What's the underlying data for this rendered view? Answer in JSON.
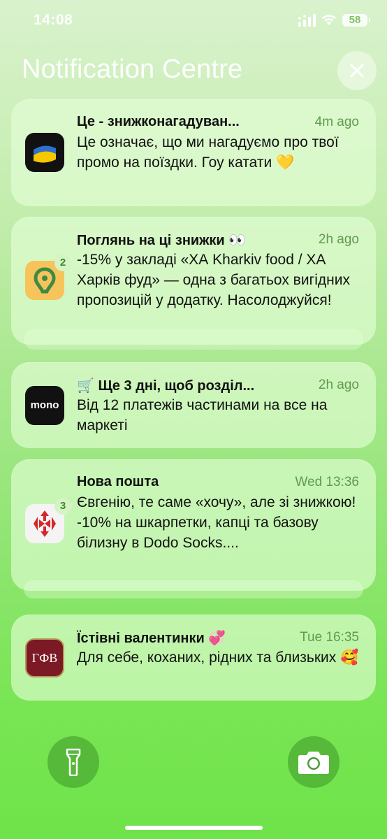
{
  "status_bar": {
    "time": "14:08",
    "battery": "58"
  },
  "header": {
    "title": "Notification Centre"
  },
  "notifications": [
    {
      "app_icon": "uklon-icon",
      "title": "Це - знижконагадуван...",
      "time": "4m ago",
      "body": "Це означає, що ми нагадуємо про твої промо на поїздки. Гоу катати 💛"
    },
    {
      "app_icon": "location-pin-app-icon",
      "badge": "2",
      "title": "Поглянь на ці знижки 👀",
      "time": "2h ago",
      "body": "-15% у закладі «ХА Kharkiv food / ХА Харків фуд» — одна з багатьох вигідних пропозицій у додатку. Насолоджуйся!"
    },
    {
      "app_icon": "monobank-icon",
      "icon_label": "mono",
      "title": "🛒 Ще 3 дні, щоб розділ...",
      "time": "2h ago",
      "body": "Від 12 платежів частинами на все на маркеті"
    },
    {
      "app_icon": "nova-poshta-icon",
      "badge": "3",
      "title": "Нова пошта",
      "time": "Wed 13:36",
      "body": "Євгенію, те саме «хочу», але зі знижкою!\n-10% на шкарпетки, капці та базову білизну в Dodo Socks...."
    },
    {
      "app_icon": "gfv-icon",
      "icon_label": "ГФВ",
      "title": "Їстівні валентинки 💞",
      "time": "Tue 16:35",
      "body": "Для себе, коханих, рідних та близьких 🥰"
    }
  ],
  "colors": {
    "accent_green": "#5f9a4d",
    "uklon_blue": "#2f6fd1",
    "uklon_yellow": "#f5c800",
    "nova_red": "#d6262b",
    "gfv_maroon": "#7b1a24"
  }
}
